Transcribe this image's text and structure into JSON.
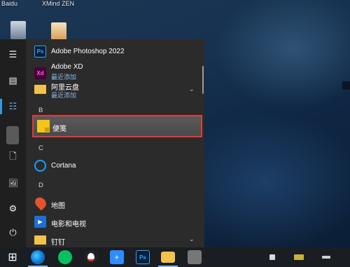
{
  "desktop": {
    "top_labels": [
      "Baidu",
      "XMind ZEN"
    ]
  },
  "rail": {
    "items": [
      {
        "name": "menu",
        "glyph": "☰"
      },
      {
        "name": "tiles",
        "glyph": "▤"
      },
      {
        "name": "all-apps",
        "glyph": "☷"
      },
      {
        "name": "documents",
        "glyph": "🗋"
      },
      {
        "name": "pictures",
        "glyph": "🖼"
      },
      {
        "name": "settings",
        "glyph": "⚙"
      },
      {
        "name": "power",
        "glyph": "⏻"
      }
    ]
  },
  "app_list": {
    "items": [
      {
        "kind": "app",
        "icon_text": "Ps",
        "icon_bg": "#001e36",
        "icon_fg": "#31a8ff",
        "label": "Adobe Photoshop 2022"
      },
      {
        "kind": "app",
        "icon_text": "Xd",
        "icon_bg": "#470137",
        "icon_fg": "#ff61f6",
        "label": "Adobe XD",
        "sub": "最近添加"
      },
      {
        "kind": "folder",
        "label": "阿里云盘",
        "sub": "最近添加"
      },
      {
        "kind": "letter",
        "label": "B"
      },
      {
        "kind": "app",
        "label": "便笺",
        "highlighted": true
      },
      {
        "kind": "letter",
        "label": "C"
      },
      {
        "kind": "app",
        "label": "Cortana"
      },
      {
        "kind": "letter",
        "label": "D"
      },
      {
        "kind": "app",
        "label": "地图"
      },
      {
        "kind": "app",
        "label": "电影和电视"
      },
      {
        "kind": "folder",
        "label": "钉钉"
      }
    ]
  },
  "taskbar": {
    "start_glyph": "⊞",
    "items": [
      {
        "name": "edge"
      },
      {
        "name": "wechat"
      },
      {
        "name": "qq"
      },
      {
        "name": "feishu"
      },
      {
        "name": "photoshop",
        "text": "Ps"
      },
      {
        "name": "file-explorer"
      },
      {
        "name": "app-blank"
      }
    ]
  },
  "colors": {
    "highlight_border": "#e53935",
    "accent": "#3a96dd",
    "panel_bg": "#2b2b2b",
    "rail_bg": "#1f1f1f"
  }
}
